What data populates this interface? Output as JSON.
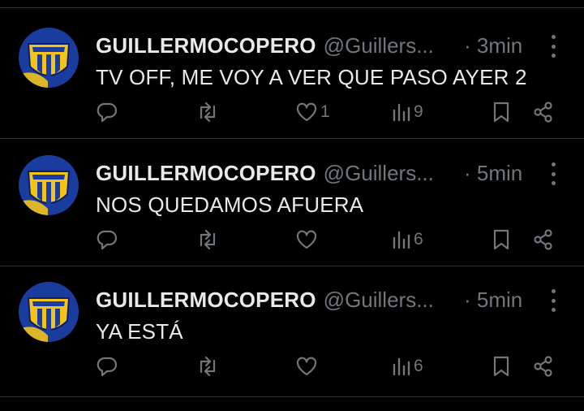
{
  "colors": {
    "background": "#000000",
    "text_primary": "#e7e9ea",
    "text_secondary": "#71767b",
    "divider": "#2f3336",
    "avatar_blue": "#1a3c9e",
    "avatar_yellow": "#f2c31b"
  },
  "icons": {
    "reply": "speech-bubble-icon",
    "retweet": "repost-arrows-icon",
    "like": "heart-outline-icon",
    "views": "bar-chart-icon",
    "bookmark": "bookmark-icon",
    "share": "share-nodes-icon",
    "more": "vertical-ellipsis-icon"
  },
  "tweets": [
    {
      "display_name": "GUILLERMOCOPERO",
      "handle": "@Guillers...",
      "time": "· 3min",
      "text": "TV OFF, ME VOY A VER QUE PASO AYER 2",
      "likes": "1",
      "views": "9"
    },
    {
      "display_name": "GUILLERMOCOPERO",
      "handle": "@Guillers...",
      "time": "· 5min",
      "text": "NOS QUEDAMOS AFUERA",
      "likes": "",
      "views": "6"
    },
    {
      "display_name": "GUILLERMOCOPERO",
      "handle": "@Guillers...",
      "time": "· 5min",
      "text": "YA ESTÁ",
      "likes": "",
      "views": "6"
    }
  ]
}
